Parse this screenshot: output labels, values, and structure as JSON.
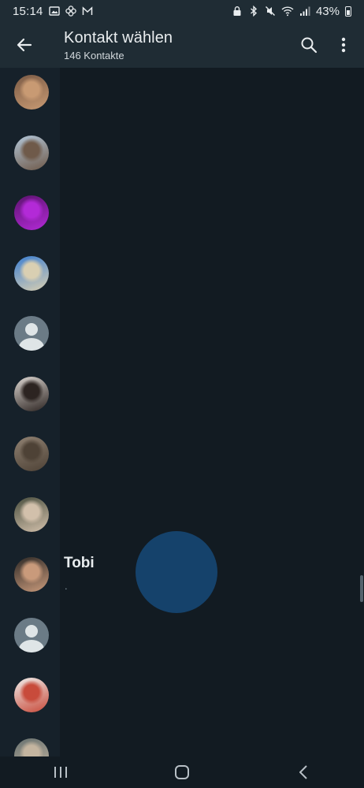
{
  "status_bar": {
    "time": "15:14",
    "battery": "43%",
    "left_icons": [
      "image-icon",
      "pinwheel-icon",
      "mail-icon"
    ],
    "right_icons": [
      "lock-icon",
      "bluetooth-icon",
      "mute-icon",
      "wifi-icon",
      "signal-icon",
      "battery-icon"
    ]
  },
  "header": {
    "back_icon": "arrow-left-icon",
    "title": "Kontakt wählen",
    "subtitle": "146 Kontakte",
    "search_icon": "search-icon",
    "more_icon": "more-vert-icon"
  },
  "contacts": [
    {
      "avatar": "photo",
      "colors": [
        "#7a5a45",
        "#c89a73"
      ]
    },
    {
      "avatar": "photo",
      "colors": [
        "#b2c6d8",
        "#6f5a4a"
      ]
    },
    {
      "avatar": "photo",
      "colors": [
        "#5c136f",
        "#b32ad7"
      ]
    },
    {
      "avatar": "photo",
      "colors": [
        "#3d7fd1",
        "#d9cfb2"
      ]
    },
    {
      "avatar": "default",
      "colors": [
        "#6b7b86",
        "#dfe5e7"
      ]
    },
    {
      "avatar": "photo",
      "colors": [
        "#dcd6d1",
        "#2c2421"
      ]
    },
    {
      "avatar": "photo",
      "colors": [
        "#8f8172",
        "#4e4236"
      ]
    },
    {
      "avatar": "photo",
      "colors": [
        "#4a4f3f",
        "#d2c0ab"
      ]
    },
    {
      "avatar": "photo",
      "colors": [
        "#2d2926",
        "#c99a7b"
      ],
      "name": "Tobi",
      "status": "."
    },
    {
      "avatar": "default",
      "colors": [
        "#6b7b86",
        "#dfe5e7"
      ]
    },
    {
      "avatar": "photo",
      "colors": [
        "#f0eeeb",
        "#c84b3b"
      ]
    },
    {
      "avatar": "photo",
      "colors": [
        "#677170",
        "#c4b5a0"
      ]
    }
  ],
  "nav_bar": {
    "recents_icon": "recents-icon",
    "home_icon": "home-icon",
    "back_icon": "nav-back-icon"
  },
  "colors": {
    "background": "#121b22",
    "app_bar": "#1f2c34",
    "text_primary": "#e9edef",
    "text_secondary": "#8696a0",
    "touch_ripple": "#15426b"
  }
}
